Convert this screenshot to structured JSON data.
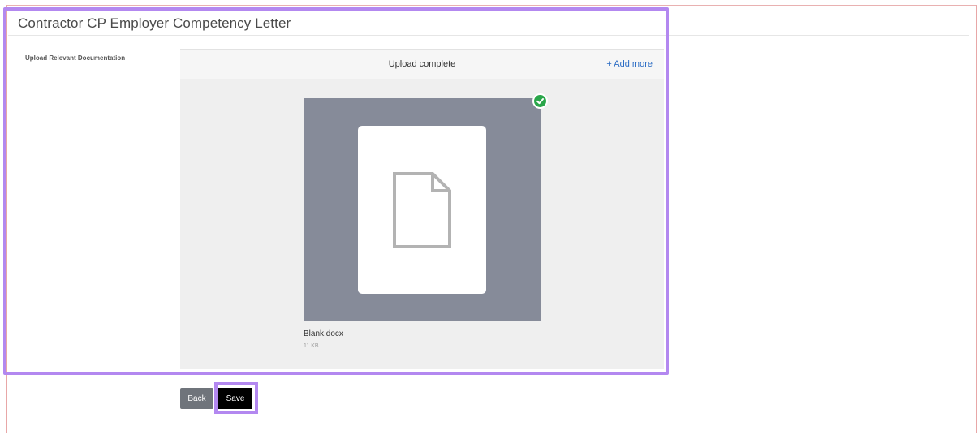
{
  "page": {
    "title": "Contractor CP Employer Competency Letter"
  },
  "form": {
    "upload_label": "Upload Relevant Documentation",
    "uploader": {
      "status": "Upload complete",
      "add_more": "+ Add more",
      "file": {
        "name": "Blank.docx",
        "size": "11 KB",
        "status_icon": "check-circle-icon",
        "type_icon": "document-icon"
      }
    }
  },
  "actions": {
    "back_label": "Back",
    "save_label": "Save"
  },
  "colors": {
    "accent_highlight": "#b388f0",
    "link": "#2b6cc4",
    "success": "#2aa64a",
    "thumbnail_bg": "#868b99",
    "save_button": "#000000",
    "back_button": "#6f747b"
  }
}
